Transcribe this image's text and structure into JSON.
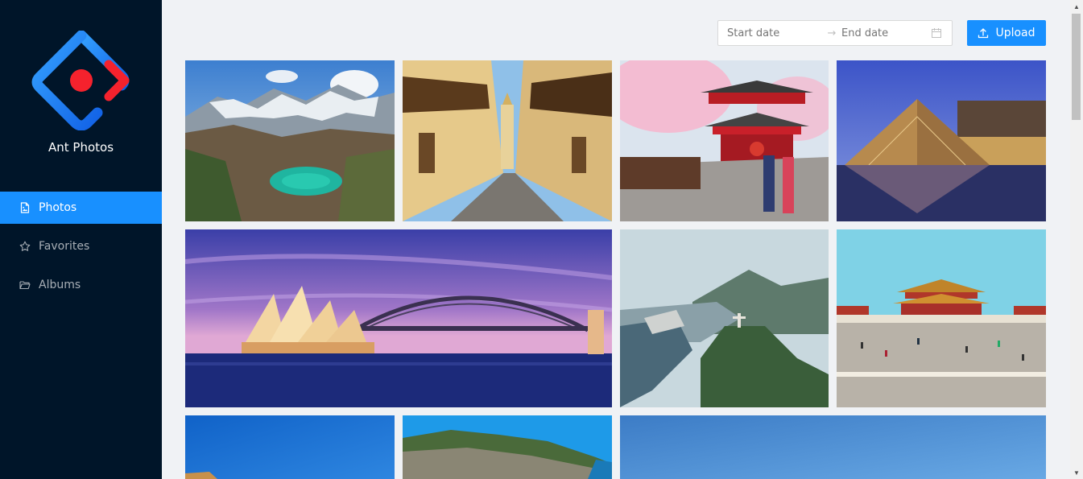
{
  "app": {
    "name": "Ant Photos"
  },
  "sidebar": {
    "items": [
      {
        "label": "Photos",
        "icon": "file-image-icon",
        "active": true
      },
      {
        "label": "Favorites",
        "icon": "star-icon",
        "active": false
      },
      {
        "label": "Albums",
        "icon": "folder-open-icon",
        "active": false
      }
    ]
  },
  "toolbar": {
    "start_placeholder": "Start date",
    "separator": "→",
    "end_placeholder": "End date",
    "upload_label": "Upload"
  },
  "colors": {
    "sidebar_bg": "#001529",
    "accent": "#1890ff",
    "content_bg": "#f0f2f5",
    "logo_red": "#f5222d"
  },
  "photos": [
    {
      "name": "photo-mountain-lake"
    },
    {
      "name": "photo-colonial-street"
    },
    {
      "name": "photo-cherry-blossom-temple"
    },
    {
      "name": "photo-louvre-pyramid"
    },
    {
      "name": "photo-sydney-harbour"
    },
    {
      "name": "photo-rio-christ-redeemer"
    },
    {
      "name": "photo-forbidden-city"
    },
    {
      "name": "photo-blue-sky"
    },
    {
      "name": "photo-coastal-town"
    },
    {
      "name": "photo-sky-panorama"
    }
  ]
}
